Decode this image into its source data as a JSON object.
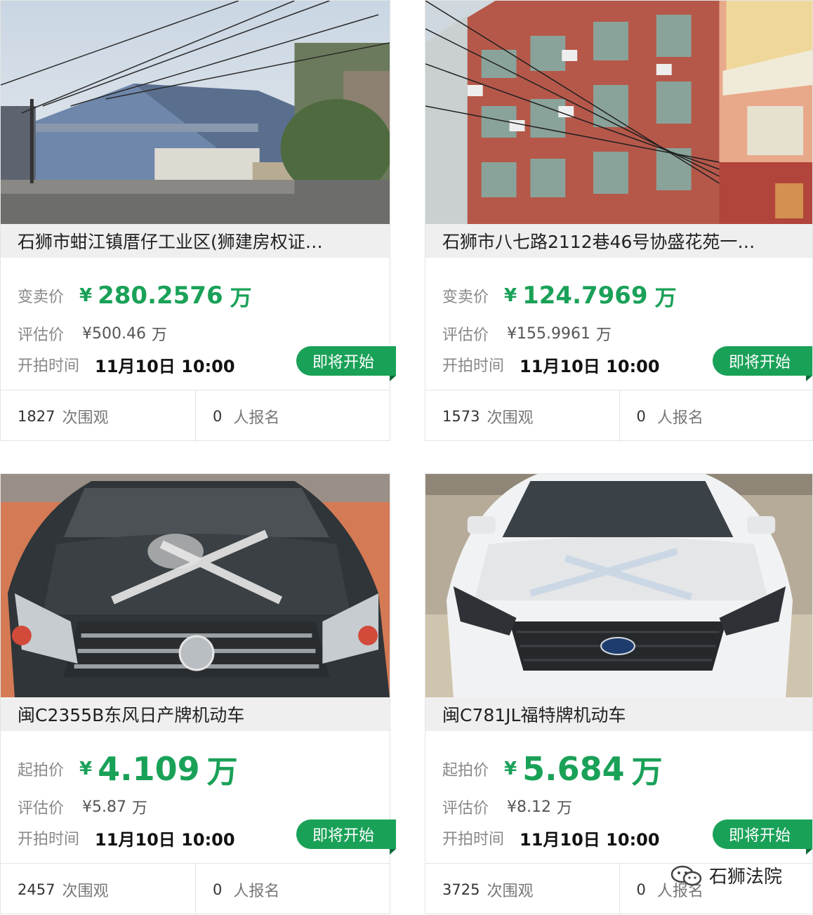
{
  "listings": [
    {
      "title": "石狮市蚶江镇厝仔工业区(狮建房权证…",
      "price_label": "变卖价",
      "currency": "¥",
      "price_value": "280.2576",
      "price_unit": "万",
      "eval_label": "评估价",
      "eval_value": "¥500.46",
      "eval_unit": "万",
      "time_label": "开拍时间",
      "time_value": "11月10日 10:00",
      "badge": "即将开始",
      "views": "1827",
      "views_label": "次围观",
      "signups": "0",
      "signups_label": "人报名",
      "photo": "warehouse-photo"
    },
    {
      "title": "石狮市八七路2112巷46号协盛花苑一…",
      "price_label": "变卖价",
      "currency": "¥",
      "price_value": "124.7969",
      "price_unit": "万",
      "eval_label": "评估价",
      "eval_value": "¥155.9961",
      "eval_unit": "万",
      "time_label": "开拍时间",
      "time_value": "11月10日 10:00",
      "badge": "即将开始",
      "views": "1573",
      "views_label": "次围观",
      "signups": "0",
      "signups_label": "人报名",
      "photo": "apartment-building-photo"
    },
    {
      "title": "闽C2355B东风日产牌机动车",
      "price_label": "起拍价",
      "currency": "¥",
      "price_value": "4.109",
      "price_unit": "万",
      "eval_label": "评估价",
      "eval_value": "¥5.87",
      "eval_unit": "万",
      "time_label": "开拍时间",
      "time_value": "11月10日 10:00",
      "badge": "即将开始",
      "views": "2457",
      "views_label": "次围观",
      "signups": "0",
      "signups_label": "人报名",
      "photo": "dark-car-photo"
    },
    {
      "title": "闽C781JL福特牌机动车",
      "price_label": "起拍价",
      "currency": "¥",
      "price_value": "5.684",
      "price_unit": "万",
      "eval_label": "评估价",
      "eval_value": "¥8.12",
      "eval_unit": "万",
      "time_label": "开拍时间",
      "time_value": "11月10日 10:00",
      "badge": "即将开始",
      "views": "3725",
      "views_label": "次围观",
      "signups": "0",
      "signups_label": "人报名",
      "photo": "white-car-photo"
    }
  ],
  "watermark": {
    "text": "石狮法院",
    "icon": "wechat-icon"
  },
  "colors": {
    "accent": "#1aa158",
    "border": "#e4e4e4",
    "title_band": "#eeeeee"
  }
}
